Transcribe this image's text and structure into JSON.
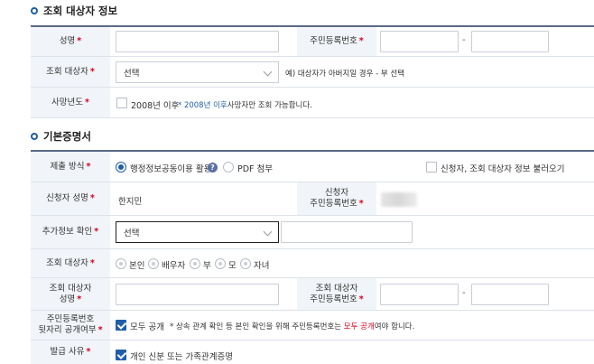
{
  "section1": {
    "title": "조회 대상자 정보",
    "name_label": "성명",
    "rrn_label": "주민등록번호",
    "target_label": "조회 대상자",
    "target_select": "선택",
    "target_note": "예) 대상자가 아버지일 경우 - 부 선택",
    "death_label": "사망년도",
    "death_checkbox": "2008년 이후",
    "death_note_prefix": "* ",
    "death_note_blue": "2008년 이후",
    "death_note_rest": "사망자만 조회 가능합니다."
  },
  "section2": {
    "title": "기본증명서",
    "submit_label": "제출 방식",
    "submit_opt1": "행정정보공동이용 활용",
    "submit_opt2": "PDF 첨부",
    "load_info": "신청자, 조회 대상자 정보 불러오기",
    "applicant_name_label": "신청자 성명",
    "applicant_name": "한지민",
    "applicant_rrn_label_1": "신청자",
    "applicant_rrn_label_2": "주민등록번호",
    "extra_label": "추가정보 확인",
    "extra_select": "선택",
    "target_label": "조회 대상자",
    "rel_opts": [
      "본인",
      "배우자",
      "부",
      "모",
      "자녀"
    ],
    "target_name_label_1": "조회 대상자",
    "target_name_label_2": "성명",
    "target_rrn_label_1": "조회 대상자",
    "target_rrn_label_2": "주민등록번호",
    "rrn_back_label_1": "주민등록번호",
    "rrn_back_label_2": "뒷자리 공개여부",
    "rrn_back_checkbox": "모두 공개",
    "rrn_back_note_prefix": "* 상속 관계 확인 등 본인 확인을 위해 주민등록번호는 ",
    "rrn_back_note_red": "모두 공개",
    "rrn_back_note_suffix": "여야 합니다.",
    "reason_label": "발급 사유",
    "reason_checkbox": "개인 신분 또는 가족관계증명"
  },
  "dash": "-",
  "required_mark": "*",
  "help_glyph": "?"
}
